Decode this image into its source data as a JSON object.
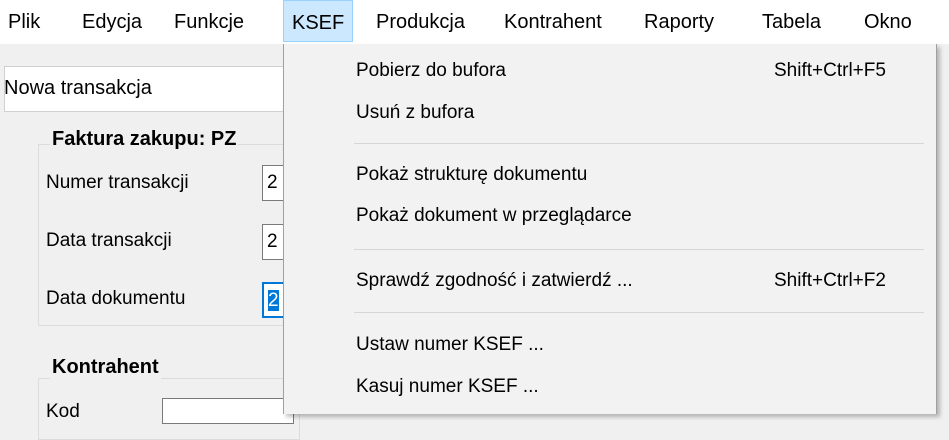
{
  "menubar": {
    "items": [
      {
        "label": "Plik"
      },
      {
        "label": "Edycja"
      },
      {
        "label": "Funkcje"
      },
      {
        "label": "KSEF"
      },
      {
        "label": "Produkcja"
      },
      {
        "label": "Kontrahent"
      },
      {
        "label": "Raporty"
      },
      {
        "label": "Tabela"
      },
      {
        "label": "Okno"
      }
    ],
    "active": "KSEF"
  },
  "window": {
    "title": "Nowa transakcja",
    "section_invoice": "Faktura zakupu: PZ",
    "fields": [
      {
        "label": "Numer transakcji",
        "value": "2"
      },
      {
        "label": "Data transakcji",
        "value": "2"
      },
      {
        "label": "Data dokumentu",
        "value": "2"
      }
    ],
    "section_contractor": "Kontrahent",
    "kod_label": "Kod"
  },
  "ksef_menu": {
    "items": [
      {
        "label": "Pobierz do bufora",
        "shortcut": "Shift+Ctrl+F5"
      },
      {
        "label": "Usuń z bufora",
        "shortcut": ""
      },
      {
        "label": "Pokaż strukturę dokumentu",
        "shortcut": ""
      },
      {
        "label": "Pokaż dokument w przeglądarce",
        "shortcut": ""
      },
      {
        "label": "Sprawdź zgodność i zatwierdź ...",
        "shortcut": "Shift+Ctrl+F2"
      },
      {
        "label": "Ustaw numer KSEF ...",
        "shortcut": ""
      },
      {
        "label": "Kasuj numer KSEF ...",
        "shortcut": ""
      }
    ]
  },
  "colors": {
    "highlight": "#cce8ff",
    "selection": "#0078d7"
  }
}
